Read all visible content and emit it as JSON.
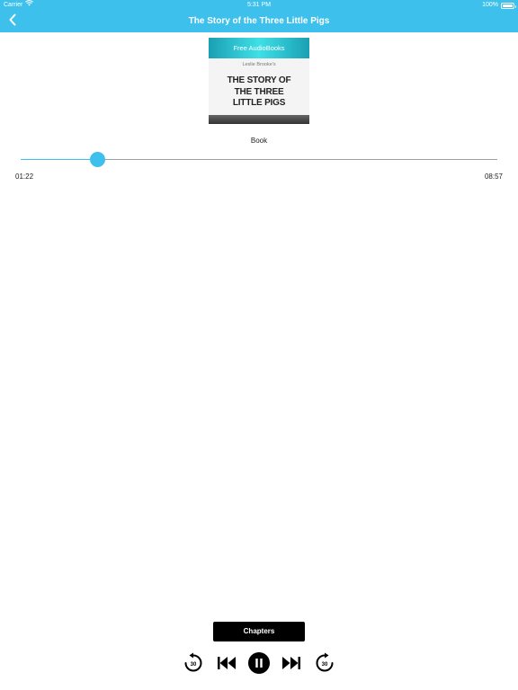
{
  "status_bar": {
    "carrier": "Carrier",
    "wifi_icon": "wifi-icon",
    "time": "5:31 PM",
    "battery_percent": "100%",
    "battery_icon": "battery-icon"
  },
  "nav": {
    "back_icon": "chevron-left-icon",
    "title": "The Story of the Three Little Pigs"
  },
  "cover": {
    "banner": "Free AudioBooks",
    "author": "Leslie Brooke's",
    "title_line1": "THE STORY OF",
    "title_line2": "THE THREE",
    "title_line3": "LITTLE PIGS"
  },
  "player": {
    "section_label": "Book",
    "elapsed": "01:22",
    "total": "08:57",
    "progress": 0.162
  },
  "controls": {
    "chapters_label": "Chapters",
    "skip_back_seconds": "30",
    "skip_forward_seconds": "30",
    "skip_back_icon": "rewind-30-icon",
    "previous_icon": "previous-track-icon",
    "pause_icon": "pause-icon",
    "next_icon": "next-track-icon",
    "skip_forward_icon": "forward-30-icon"
  },
  "colors": {
    "accent": "#3dc1ec",
    "button_dark": "#000000",
    "background": "#ffffff"
  }
}
